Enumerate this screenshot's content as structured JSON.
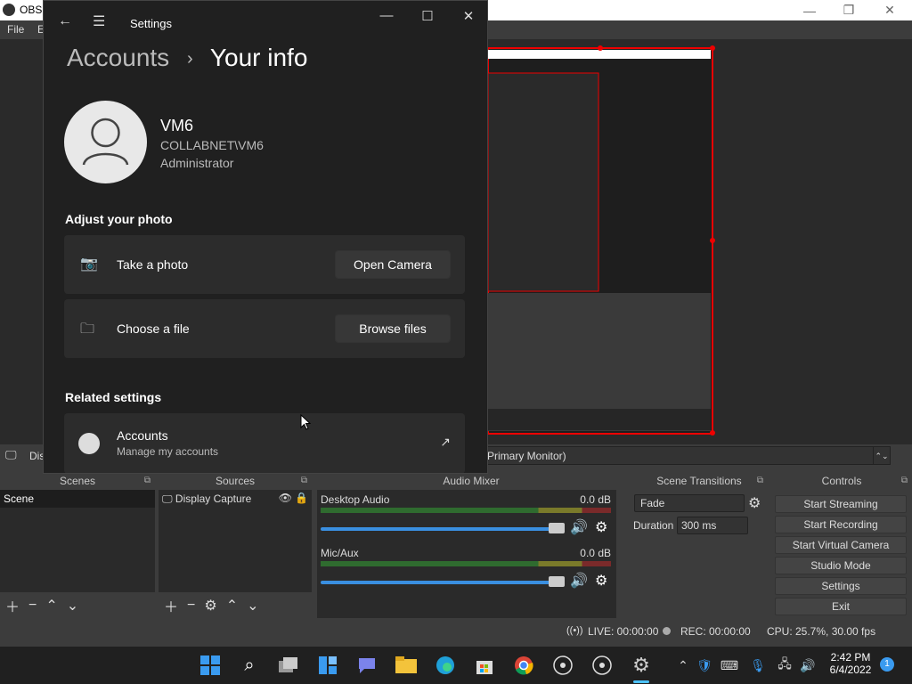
{
  "obs": {
    "title": "OBS",
    "menu": [
      "File",
      "E"
    ],
    "source_combo": "Primary Monitor)",
    "source_label": "Dis",
    "docks": {
      "scenes": {
        "title": "Scenes",
        "items": [
          "Scene"
        ]
      },
      "sources": {
        "title": "Sources",
        "items": [
          "Display Capture"
        ]
      },
      "mixer": {
        "title": "Audio Mixer",
        "channels": [
          {
            "name": "Desktop Audio",
            "db": "0.0 dB"
          },
          {
            "name": "Mic/Aux",
            "db": "0.0 dB"
          }
        ],
        "scale": [
          "-60",
          "-55",
          "-50",
          "-45",
          "-40",
          "-35",
          "-30",
          "-25",
          "-20",
          "-15",
          "-10",
          "-5",
          "0"
        ]
      },
      "transitions": {
        "title": "Scene Transitions",
        "transition": "Fade",
        "duration_label": "Duration",
        "duration_value": "300 ms"
      },
      "controls": {
        "title": "Controls",
        "buttons": [
          "Start Streaming",
          "Start Recording",
          "Start Virtual Camera",
          "Studio Mode",
          "Settings",
          "Exit"
        ]
      }
    },
    "status": {
      "live": "LIVE: 00:00:00",
      "rec": "REC: 00:00:00",
      "cpu": "CPU: 25.7%, 30.00 fps"
    }
  },
  "settings": {
    "window_title": "Settings",
    "breadcrumb_parent": "Accounts",
    "breadcrumb_current": "Your info",
    "user": {
      "name": "VM6",
      "domain": "COLLABNET\\VM6",
      "role": "Administrator"
    },
    "adjust_heading": "Adjust your photo",
    "take_photo": {
      "label": "Take a photo",
      "button": "Open Camera"
    },
    "choose_file": {
      "label": "Choose a file",
      "button": "Browse files"
    },
    "related_heading": "Related settings",
    "accounts_link": {
      "title": "Accounts",
      "subtitle": "Manage my accounts"
    }
  },
  "taskbar": {
    "time": "2:42 PM",
    "date": "6/4/2022",
    "notification_count": "1"
  }
}
